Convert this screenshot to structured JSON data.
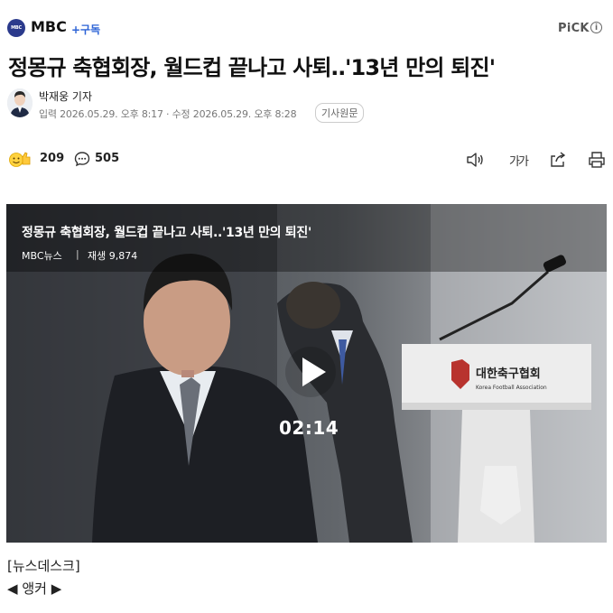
{
  "header": {
    "press_logo_text": "MBC",
    "press_name": "MBC",
    "subscribe_label": "+구독",
    "pick_label": "PiCK",
    "info_symbol": "i"
  },
  "article": {
    "headline": "정몽규 축협회장, 월드컵 끝나고 사퇴‥'13년 만의 퇴진'",
    "reporter": "박재웅 기자",
    "dates": "입력 2026.05.29. 오후 8:17 · 수정 2026.05.29. 오후 8:28",
    "original_label": "기사원문"
  },
  "reactions": {
    "count": "209",
    "comments": "505"
  },
  "tools": {
    "font_size_label": "가가"
  },
  "video": {
    "title": "정몽규 축협회장, 월드컵 끝나고 사퇴..'13년 만의 퇴진'",
    "source": "MBC뉴스",
    "separator": "|",
    "plays": "재생 9,874",
    "duration": "02:14",
    "podium_text_ko": "대한축구협회",
    "podium_text_en": "Korea Football Association"
  },
  "body": {
    "section": "[뉴스데스크]",
    "anchor_left": "◀",
    "anchor": "앵커",
    "anchor_right": "▶"
  },
  "colors": {
    "brand_blue": "#2b3a8c",
    "subscribe": "#2b62d6"
  }
}
